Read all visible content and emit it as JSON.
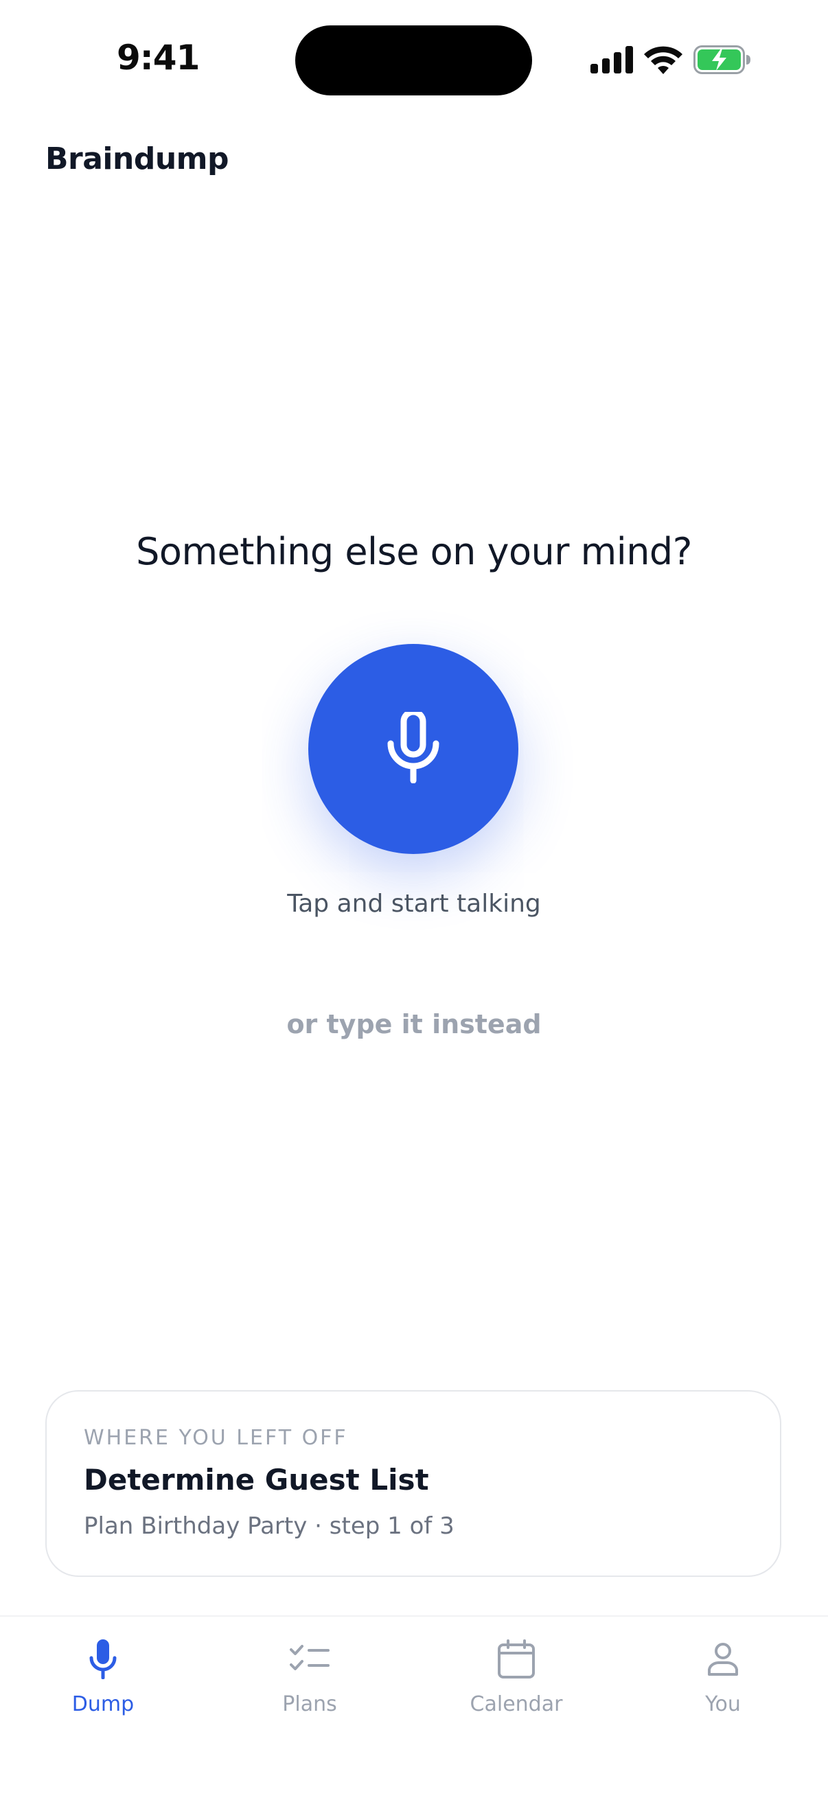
{
  "status_bar": {
    "time": "9:41"
  },
  "header": {
    "title": "Braindump"
  },
  "main": {
    "prompt": "Something else on your mind?",
    "mic_caption": "Tap and start talking",
    "type_link": "or type it instead"
  },
  "resume_card": {
    "eyebrow": "WHERE YOU LEFT OFF",
    "title": "Determine Guest List",
    "subtitle": "Plan Birthday Party · step 1 of 3"
  },
  "tabs": [
    {
      "label": "Dump",
      "icon": "microphone-icon",
      "active": true
    },
    {
      "label": "Plans",
      "icon": "checklist-icon",
      "active": false
    },
    {
      "label": "Calendar",
      "icon": "calendar-icon",
      "active": false
    },
    {
      "label": "You",
      "icon": "person-icon",
      "active": false
    }
  ],
  "colors": {
    "accent": "#2c5de5",
    "muted": "#9ca3af",
    "text": "#111827",
    "battery": "#34c759"
  }
}
